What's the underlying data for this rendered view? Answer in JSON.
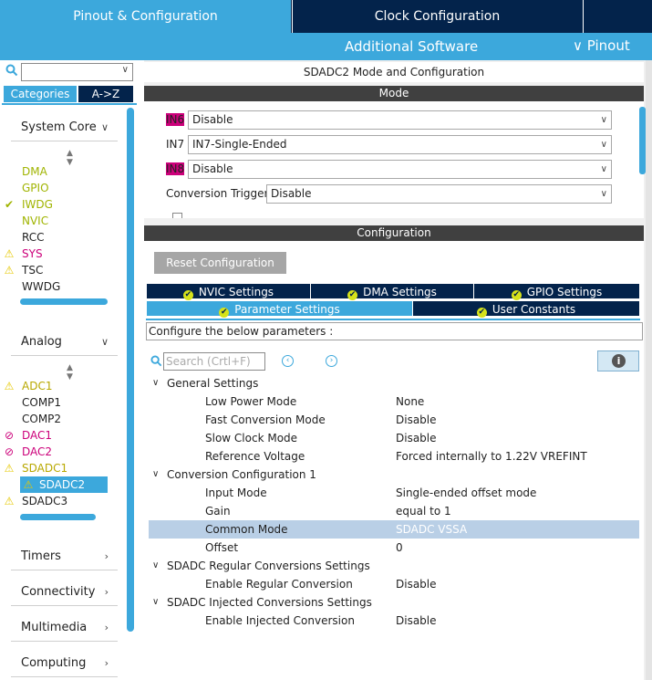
{
  "tabs": {
    "pinout_config": "Pinout & Configuration",
    "clock_config": "Clock Configuration"
  },
  "subbar": {
    "additional_software": "Additional Software",
    "pinout": "Pinout"
  },
  "left": {
    "categories_label": "Categories",
    "az_label": "A->Z",
    "groups": [
      {
        "label": "System Core",
        "items": [
          {
            "label": "DMA",
            "status": "none",
            "color": "green"
          },
          {
            "label": "GPIO",
            "status": "none",
            "color": "green"
          },
          {
            "label": "IWDG",
            "status": "ok",
            "color": "green"
          },
          {
            "label": "NVIC",
            "status": "none",
            "color": "green"
          },
          {
            "label": "RCC",
            "status": "none",
            "color": "dark"
          },
          {
            "label": "SYS",
            "status": "warning",
            "color": "pink"
          },
          {
            "label": "TSC",
            "status": "warning",
            "color": "dark"
          },
          {
            "label": "WWDG",
            "status": "none",
            "color": "dark"
          }
        ]
      },
      {
        "label": "Analog",
        "items": [
          {
            "label": "ADC1",
            "status": "warning",
            "color": "warn"
          },
          {
            "label": "COMP1",
            "status": "none",
            "color": "dark"
          },
          {
            "label": "COMP2",
            "status": "none",
            "color": "dark"
          },
          {
            "label": "DAC1",
            "status": "blocked",
            "color": "pink"
          },
          {
            "label": "DAC2",
            "status": "blocked",
            "color": "pink"
          },
          {
            "label": "SDADC1",
            "status": "warning",
            "color": "warn"
          },
          {
            "label": "SDADC2",
            "status": "warning",
            "color": "selected"
          },
          {
            "label": "SDADC3",
            "status": "warning",
            "color": "dark"
          }
        ]
      },
      {
        "label": "Timers"
      },
      {
        "label": "Connectivity"
      },
      {
        "label": "Multimedia"
      },
      {
        "label": "Computing"
      }
    ]
  },
  "panel_title": "SDADC2 Mode and Configuration",
  "mode": {
    "header": "Mode",
    "rows": [
      {
        "label": "IN6",
        "value": "Disable",
        "highlight": true
      },
      {
        "label": "IN7",
        "value": "IN7-Single-Ended",
        "highlight": false
      },
      {
        "label": "IN8",
        "value": "Disable",
        "highlight": true
      },
      {
        "label": "Conversion Trigger",
        "value": "Disable",
        "highlight": false
      }
    ]
  },
  "configuration": {
    "header": "Configuration",
    "reset_label": "Reset Configuration",
    "tabs_row1": [
      "NVIC Settings",
      "DMA Settings",
      "GPIO Settings"
    ],
    "tabs_row2": [
      "Parameter Settings",
      "User Constants"
    ],
    "active_tab": "Parameter Settings",
    "instruction": "Configure the below parameters :",
    "search_placeholder": "Search (Crtl+F)",
    "params": [
      {
        "type": "group",
        "name": "General Settings"
      },
      {
        "type": "param",
        "name": "Low Power Mode",
        "value": "None"
      },
      {
        "type": "param",
        "name": "Fast Conversion Mode",
        "value": "Disable"
      },
      {
        "type": "param",
        "name": "Slow Clock Mode",
        "value": "Disable"
      },
      {
        "type": "param",
        "name": "Reference Voltage",
        "value": "Forced internally to 1.22V VREFINT"
      },
      {
        "type": "group",
        "name": "Conversion Configuration 1"
      },
      {
        "type": "param",
        "name": "Input Mode",
        "value": "Single-ended offset mode"
      },
      {
        "type": "param",
        "name": "Gain",
        "value": "equal to 1"
      },
      {
        "type": "param",
        "name": "Common Mode",
        "value": "SDADC VSSA",
        "selected": true
      },
      {
        "type": "param",
        "name": "Offset",
        "value": "0"
      },
      {
        "type": "group",
        "name": "SDADC Regular Conversions Settings"
      },
      {
        "type": "param",
        "name": "Enable Regular Conversion",
        "value": "Disable"
      },
      {
        "type": "group",
        "name": "SDADC Injected Conversions Settings"
      },
      {
        "type": "param",
        "name": "Enable Injected Conversion",
        "value": "Disable"
      }
    ]
  },
  "colors": {
    "accent": "#3ca8dc",
    "navy": "#03234b",
    "warning": "#e6c800",
    "error_pink": "#cc007a",
    "green": "#a0b400"
  }
}
